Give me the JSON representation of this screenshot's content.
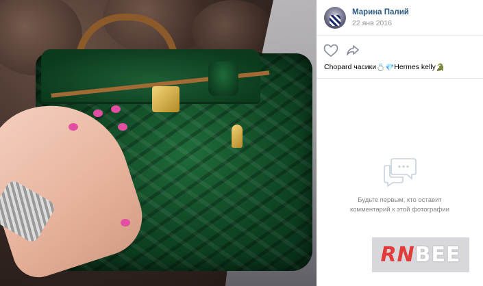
{
  "post": {
    "author": "Марина Палий",
    "date": "22 янв 2016",
    "caption_text_1": "Chopard часики",
    "caption_text_2": "Hermes kelly",
    "caption_emoji_1": "💍",
    "caption_emoji_2": "💎",
    "caption_emoji_3": "🐊"
  },
  "actions": {
    "like_icon": "heart-icon",
    "share_icon": "share-arrow-icon"
  },
  "comments": {
    "empty_line1": "Будьте первым, кто оставит",
    "empty_line2": "комментарий к этой фотографии"
  },
  "watermark": {
    "part1": "RN",
    "part2": "BEE"
  },
  "colors": {
    "link": "#2a5885",
    "muted": "#939393",
    "divider": "#e7e8ec",
    "icon": "#828a99"
  }
}
